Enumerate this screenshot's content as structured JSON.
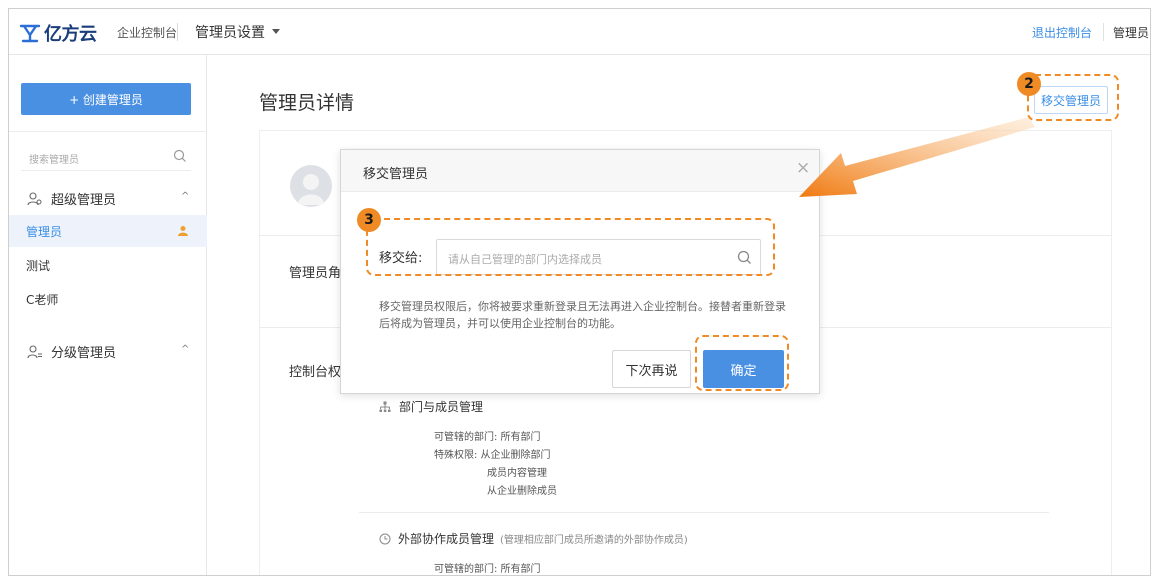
{
  "topbar": {
    "logo_text": "亿方云",
    "console_label": "企业控制台",
    "menu_title": "管理员设置",
    "exit_link": "退出控制台",
    "admin_label": "管理员"
  },
  "sidebar": {
    "create_button": "+ 创建管理员",
    "search_placeholder": "搜索管理员",
    "groups": [
      {
        "label": "超级管理员",
        "caret": "^"
      },
      {
        "label": "分级管理员",
        "caret": "^"
      }
    ],
    "items": [
      {
        "label": "管理员",
        "active": true
      },
      {
        "label": "测试"
      },
      {
        "label": "C老师"
      }
    ]
  },
  "main": {
    "page_title": "管理员详情",
    "transfer_button": "移交管理员",
    "role_label": "管理员角",
    "perm_label": "控制台权",
    "dept_section": {
      "title": "部门与成员管理",
      "lines": [
        "可管辖的部门: 所有部门",
        "特殊权限: 从企业删除部门",
        "成员内容管理",
        "从企业删除成员"
      ]
    },
    "external_section": {
      "title": "外部协作成员管理",
      "note": "(管理相应部门成员所邀请的外部协作成员)",
      "lines": [
        "可管辖的部门: 所有部门"
      ]
    }
  },
  "modal": {
    "title": "移交管理员",
    "close": "×",
    "field_label": "移交给:",
    "field_placeholder": "请从自己管理的部门内选择成员",
    "hint": "移交管理员权限后，你将被要求重新登录且无法再进入企业控制台。接替者重新登录后将成为管理员，并可以使用企业控制台的功能。",
    "cancel_button": "下次再说",
    "confirm_button": "确定"
  },
  "annotations": {
    "step_2": "2",
    "step_3": "3",
    "color": "#f08a24"
  },
  "colors": {
    "accent": "#4a90e2",
    "link": "#3a8ee6"
  }
}
